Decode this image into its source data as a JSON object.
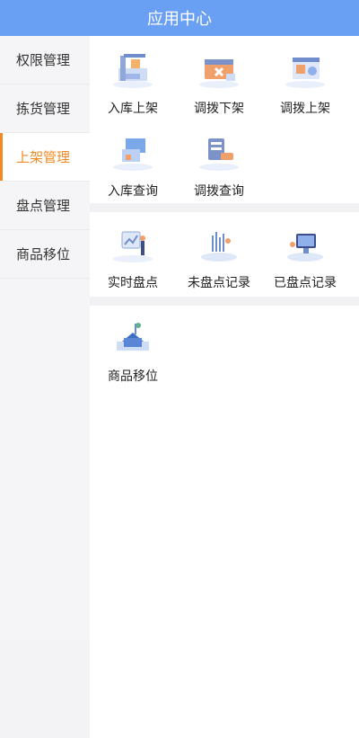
{
  "header": {
    "title": "应用中心"
  },
  "sidebar": {
    "items": [
      {
        "label": "权限管理",
        "active": false
      },
      {
        "label": "拣货管理",
        "active": false
      },
      {
        "label": "上架管理",
        "active": true
      },
      {
        "label": "盘点管理",
        "active": false
      },
      {
        "label": "商品移位",
        "active": false
      }
    ]
  },
  "sections": {
    "putaway": [
      {
        "label": "入库上架",
        "icon": "warehouse-putaway-icon"
      },
      {
        "label": "调拨下架",
        "icon": "transfer-unshelve-icon"
      },
      {
        "label": "调拨上架",
        "icon": "transfer-shelve-icon"
      },
      {
        "label": "入库查询",
        "icon": "inbound-query-icon"
      },
      {
        "label": "调拨查询",
        "icon": "transfer-query-icon"
      }
    ],
    "inventory": [
      {
        "label": "实时盘点",
        "icon": "realtime-count-icon"
      },
      {
        "label": "未盘点记录",
        "icon": "uncounted-records-icon"
      },
      {
        "label": "已盘点记录",
        "icon": "counted-records-icon"
      }
    ],
    "relocation": [
      {
        "label": "商品移位",
        "icon": "product-relocation-icon"
      }
    ]
  },
  "colors": {
    "header_bg": "#6aa0f3",
    "accent": "#f08a24"
  }
}
